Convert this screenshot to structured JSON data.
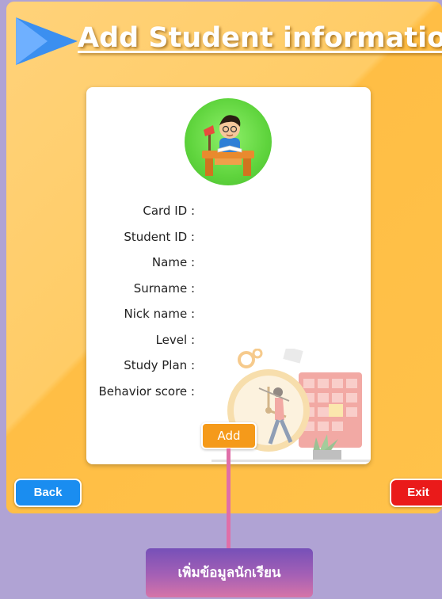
{
  "header": {
    "title": "Add Student information"
  },
  "form": {
    "fields": [
      "Card ID :",
      "Student ID :",
      "Name :",
      "Surname :",
      "Nick name :",
      "Level :",
      "Study Plan :",
      "Behavior score :"
    ],
    "add_label": "Add"
  },
  "nav": {
    "back_label": "Back",
    "exit_label": "Exit"
  },
  "callout": {
    "text": "เพิ่มข้อมูลนักเรียน"
  },
  "icons": {
    "title_arrow": "play-triangle-icon",
    "avatar": "student-reading-avatar-icon",
    "illustration": "clock-calendar-runner-illustration"
  },
  "colors": {
    "background": "#b0a3d4",
    "panel": "#ffc34d",
    "title_arrow": "#3b8ff0",
    "add_button": "#f59a1a",
    "back_button": "#1a8df0",
    "exit_button": "#ea1a1a",
    "connector": "#e06fa8",
    "callout": "#8a57b6"
  }
}
